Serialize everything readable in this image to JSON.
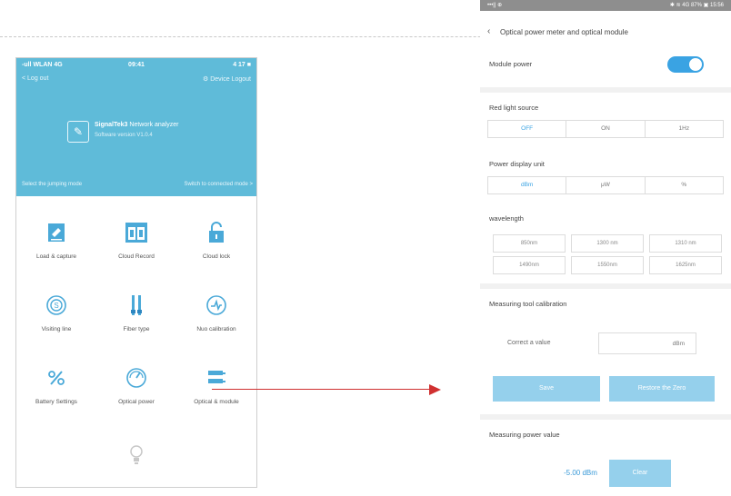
{
  "left_phone": {
    "status": {
      "carrier": "-ull WLAN 4G",
      "time": "09:41",
      "battery": "4 17 ■"
    },
    "nav": {
      "left": "< Log out",
      "right": "⚙ Device Logout"
    },
    "device": {
      "name": "SignalTek3",
      "subtitle": "Network analyzer",
      "serial": "Software version V1.0.4"
    },
    "bar": {
      "left": "Select the jumping mode",
      "right": "Switch to connected mode >"
    },
    "grid_items": [
      {
        "label": "Load & capture",
        "icon": "edit-note-icon"
      },
      {
        "label": "Cloud Record",
        "icon": "cloud-record-icon"
      },
      {
        "label": "Cloud lock",
        "icon": "unlock-icon"
      },
      {
        "label": "Visiting line",
        "icon": "visiting-line-icon"
      },
      {
        "label": "Fiber type",
        "icon": "fiber-type-icon"
      },
      {
        "label": "Nuo calibration",
        "icon": "calibration-icon"
      },
      {
        "label": "Battery Settings",
        "icon": "percent-icon"
      },
      {
        "label": "Optical power",
        "icon": "power-meter-icon"
      },
      {
        "label": "Optical & module",
        "icon": "optical-module-icon"
      }
    ],
    "bottom_icon": "bulb-icon"
  },
  "right_phone": {
    "status": {
      "left": "•••|| ⊕",
      "right": "✱ ≋ 4G 87% ▣ 15:56"
    },
    "title": "Optical power meter and optical module",
    "module_power": {
      "label": "Module power",
      "on": true
    },
    "red_light": {
      "label": "Red light source",
      "options": [
        "OFF",
        "ON",
        "1Hz"
      ],
      "selected": 0
    },
    "power_unit": {
      "label": "Power display unit",
      "options": [
        "dBm",
        "μW",
        "%"
      ],
      "selected": 0
    },
    "wavelength": {
      "label": "wavelength",
      "options": [
        "850nm",
        "1300 nm",
        "1310 nm",
        "1490nm",
        "1550nm",
        "1625nm"
      ]
    },
    "calibration": {
      "label": "Measuring tool calibration",
      "field_label": "Correct a value",
      "field_value": "dBm"
    },
    "buttons": {
      "save": "Save",
      "restore": "Restore the Zero"
    },
    "power_value": {
      "label": "Measuring power value",
      "value": "-5.00 dBm",
      "button": "Clear"
    }
  },
  "colors": {
    "accent": "#5fbbd9",
    "button": "#95d0ec",
    "toggle": "#3aa3e3",
    "arrow": "#d03030"
  }
}
